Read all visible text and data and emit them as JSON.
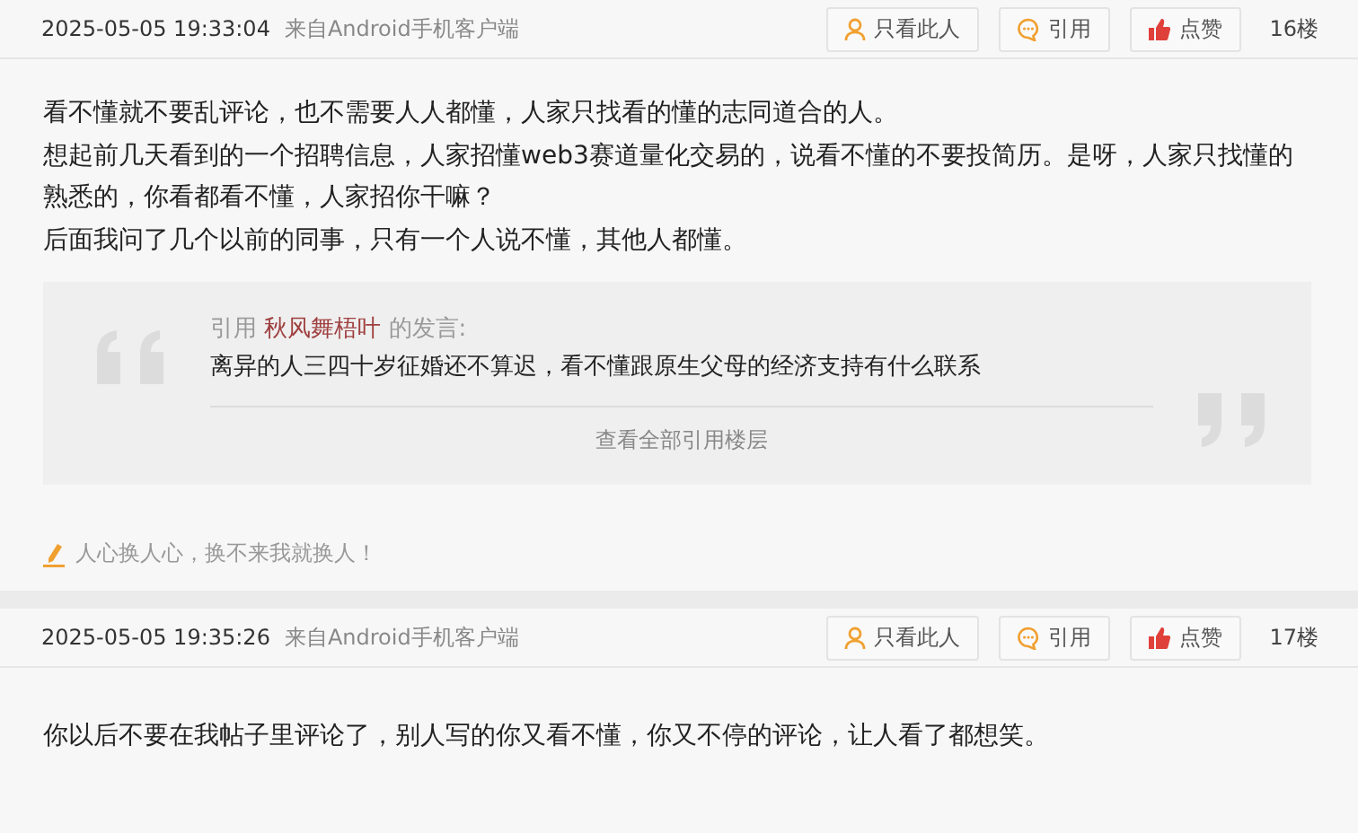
{
  "posts": [
    {
      "time": "2025-05-05 19:33:04",
      "source": "来自Android手机客户端",
      "actions": [
        {
          "kind": "only",
          "label": "只看此人"
        },
        {
          "kind": "quote",
          "label": "引用"
        },
        {
          "kind": "like",
          "label": "点赞"
        }
      ],
      "floor": "16楼",
      "paragraphs": [
        "看不懂就不要乱评论，也不需要人人都懂，人家只找看的懂的志同道合的人。",
        "想起前几天看到的一个招聘信息，人家招懂web3赛道量化交易的，说看不懂的不要投简历。是呀，人家只找懂的熟悉的，你看都看不懂，人家招你干嘛？",
        "后面我问了几个以前的同事，只有一个人说不懂，其他人都懂。"
      ],
      "quote": {
        "prefix": "引用",
        "author": "秋风舞梧叶",
        "suffix": "的发言:",
        "text": "离异的人三四十岁征婚还不算迟，看不懂跟原生父母的经济支持有什么联系",
        "more": "查看全部引用楼层"
      },
      "signature": "人心换人心，换不来我就换人！"
    },
    {
      "time": "2025-05-05 19:35:26",
      "source": "来自Android手机客户端",
      "actions": [
        {
          "kind": "only",
          "label": "只看此人"
        },
        {
          "kind": "quote",
          "label": "引用"
        },
        {
          "kind": "like",
          "label": "点赞"
        }
      ],
      "floor": "17楼",
      "paragraphs": [
        "你以后不要在我帖子里评论了，别人写的你又看不懂，你又不停的评论，让人看了都想笑。"
      ]
    }
  ]
}
